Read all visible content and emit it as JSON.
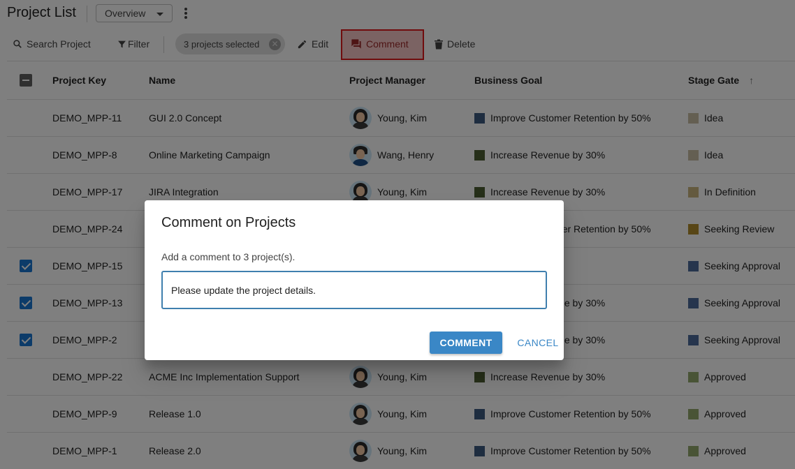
{
  "header": {
    "title": "Project List",
    "view_selected": "Overview"
  },
  "toolbar": {
    "search_label": "Search Project",
    "filter_label": "Filter",
    "selection_chip": "3 projects selected",
    "edit_label": "Edit",
    "comment_label": "Comment",
    "delete_label": "Delete"
  },
  "table": {
    "columns": [
      "Project Key",
      "Name",
      "Project Manager",
      "Business Goal",
      "Stage Gate"
    ],
    "sort_column": "Stage Gate",
    "rows": [
      {
        "key": "DEMO_MPP-11",
        "name": "GUI 2.0 Concept",
        "manager": "Young, Kim",
        "goal": "Improve Customer Retention by 50%",
        "goal_color": "#3d5a80",
        "stage": "Idea",
        "stage_color": "#c8bfa4",
        "selected": false
      },
      {
        "key": "DEMO_MPP-8",
        "name": "Online Marketing Campaign",
        "manager": "Wang, Henry",
        "goal": "Increase Revenue by 30%",
        "goal_color": "#4c5f33",
        "stage": "Idea",
        "stage_color": "#c8bfa4",
        "selected": false
      },
      {
        "key": "DEMO_MPP-17",
        "name": "JIRA Integration",
        "manager": "Young, Kim",
        "goal": "Increase Revenue by 30%",
        "goal_color": "#4c5f33",
        "stage": "In Definition",
        "stage_color": "#c9b57f",
        "selected": false
      },
      {
        "key": "DEMO_MPP-24",
        "name": "",
        "manager": "",
        "goal": "Improve Customer Retention by 50%",
        "goal_color": "#3d5a80",
        "stage": "Seeking Review",
        "stage_color": "#b08c2d",
        "selected": false
      },
      {
        "key": "DEMO_MPP-15",
        "name": "",
        "manager": "",
        "goal": "",
        "goal_color": "#3d5a80",
        "stage": "Seeking Approval",
        "stage_color": "#4c6b9a",
        "selected": true
      },
      {
        "key": "DEMO_MPP-13",
        "name": "",
        "manager": "",
        "goal": "Increase Revenue by 30%",
        "goal_color": "#4c5f33",
        "stage": "Seeking Approval",
        "stage_color": "#4c6b9a",
        "selected": true
      },
      {
        "key": "DEMO_MPP-2",
        "name": "",
        "manager": "",
        "goal": "Increase Revenue by 30%",
        "goal_color": "#4c5f33",
        "stage": "Seeking Approval",
        "stage_color": "#4c6b9a",
        "selected": true
      },
      {
        "key": "DEMO_MPP-22",
        "name": "ACME Inc Implementation Support",
        "manager": "Young, Kim",
        "goal": "Increase Revenue by 30%",
        "goal_color": "#4c5f33",
        "stage": "Approved",
        "stage_color": "#93a86c",
        "selected": false
      },
      {
        "key": "DEMO_MPP-9",
        "name": "Release 1.0",
        "manager": "Young, Kim",
        "goal": "Improve Customer Retention by 50%",
        "goal_color": "#3d5a80",
        "stage": "Approved",
        "stage_color": "#93a86c",
        "selected": false
      },
      {
        "key": "DEMO_MPP-1",
        "name": "Release 2.0",
        "manager": "Young, Kim",
        "goal": "Improve Customer Retention by 50%",
        "goal_color": "#3d5a80",
        "stage": "Approved",
        "stage_color": "#93a86c",
        "selected": false
      }
    ]
  },
  "dialog": {
    "title": "Comment on Projects",
    "message": "Add a comment to 3 project(s).",
    "input_value": "Please update the project details.",
    "confirm_label": "COMMENT",
    "cancel_label": "CANCEL"
  }
}
